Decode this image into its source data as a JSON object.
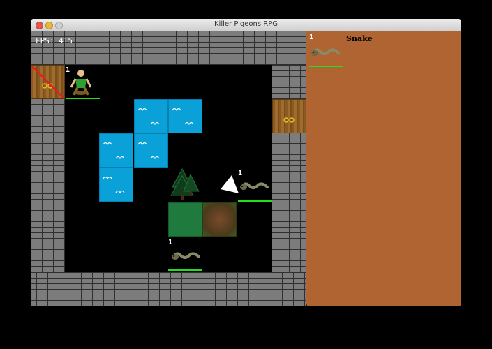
{
  "window": {
    "title": "Killer Pigeons RPG"
  },
  "hud": {
    "fps_label": "FPS: 415"
  },
  "entities": {
    "player": {
      "level": "1",
      "icon": "hero-sprite"
    },
    "snake_east": {
      "level": "1",
      "icon": "snake-sprite"
    },
    "snake_south": {
      "level": "1",
      "icon": "snake-sprite"
    }
  },
  "side_panel": {
    "target": {
      "level": "1",
      "name": "Snake",
      "icon": "snake-sprite"
    }
  },
  "colors": {
    "water": "#0aa1d8",
    "grass": "#1f7a3e",
    "wall": "#7c7c7c",
    "panel": "#b06432",
    "health": "#20e020"
  }
}
